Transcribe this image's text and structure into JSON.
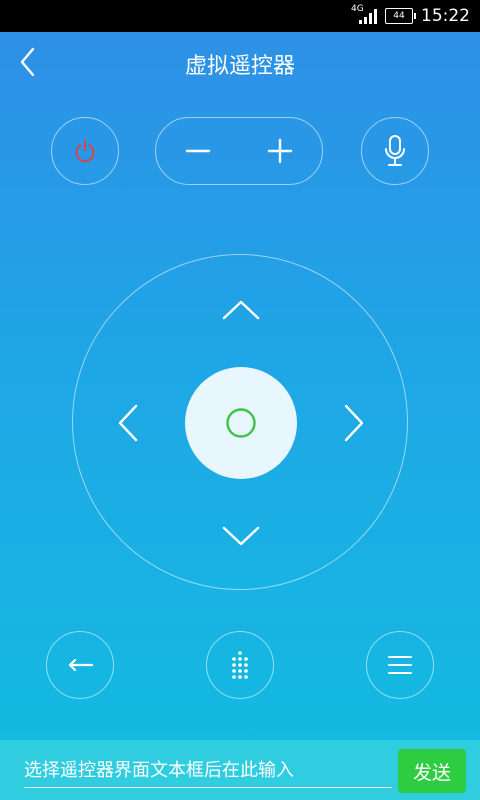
{
  "status_bar": {
    "network_type": "4G",
    "battery_level": "44",
    "time": "15:22"
  },
  "header": {
    "title": "虚拟遥控器",
    "back_icon": "chevron-left-icon"
  },
  "controls": {
    "power_icon": "power-icon",
    "volume_down_icon": "minus-icon",
    "volume_up_icon": "plus-icon",
    "mic_icon": "microphone-icon",
    "up_icon": "chevron-up-icon",
    "down_icon": "chevron-down-icon",
    "left_icon": "chevron-left-icon",
    "right_icon": "chevron-right-icon",
    "ok_icon": "ok-circle-icon",
    "back_icon": "arrow-left-icon",
    "numpad_icon": "dot-grid-icon",
    "menu_icon": "menu-icon"
  },
  "input": {
    "placeholder": "选择遥控器界面文本框后在此输入",
    "value": ""
  },
  "send_button": {
    "label": "发送"
  },
  "colors": {
    "power": "#e0404a",
    "ok_ring": "#3cc24a",
    "send": "#2ecc40"
  }
}
